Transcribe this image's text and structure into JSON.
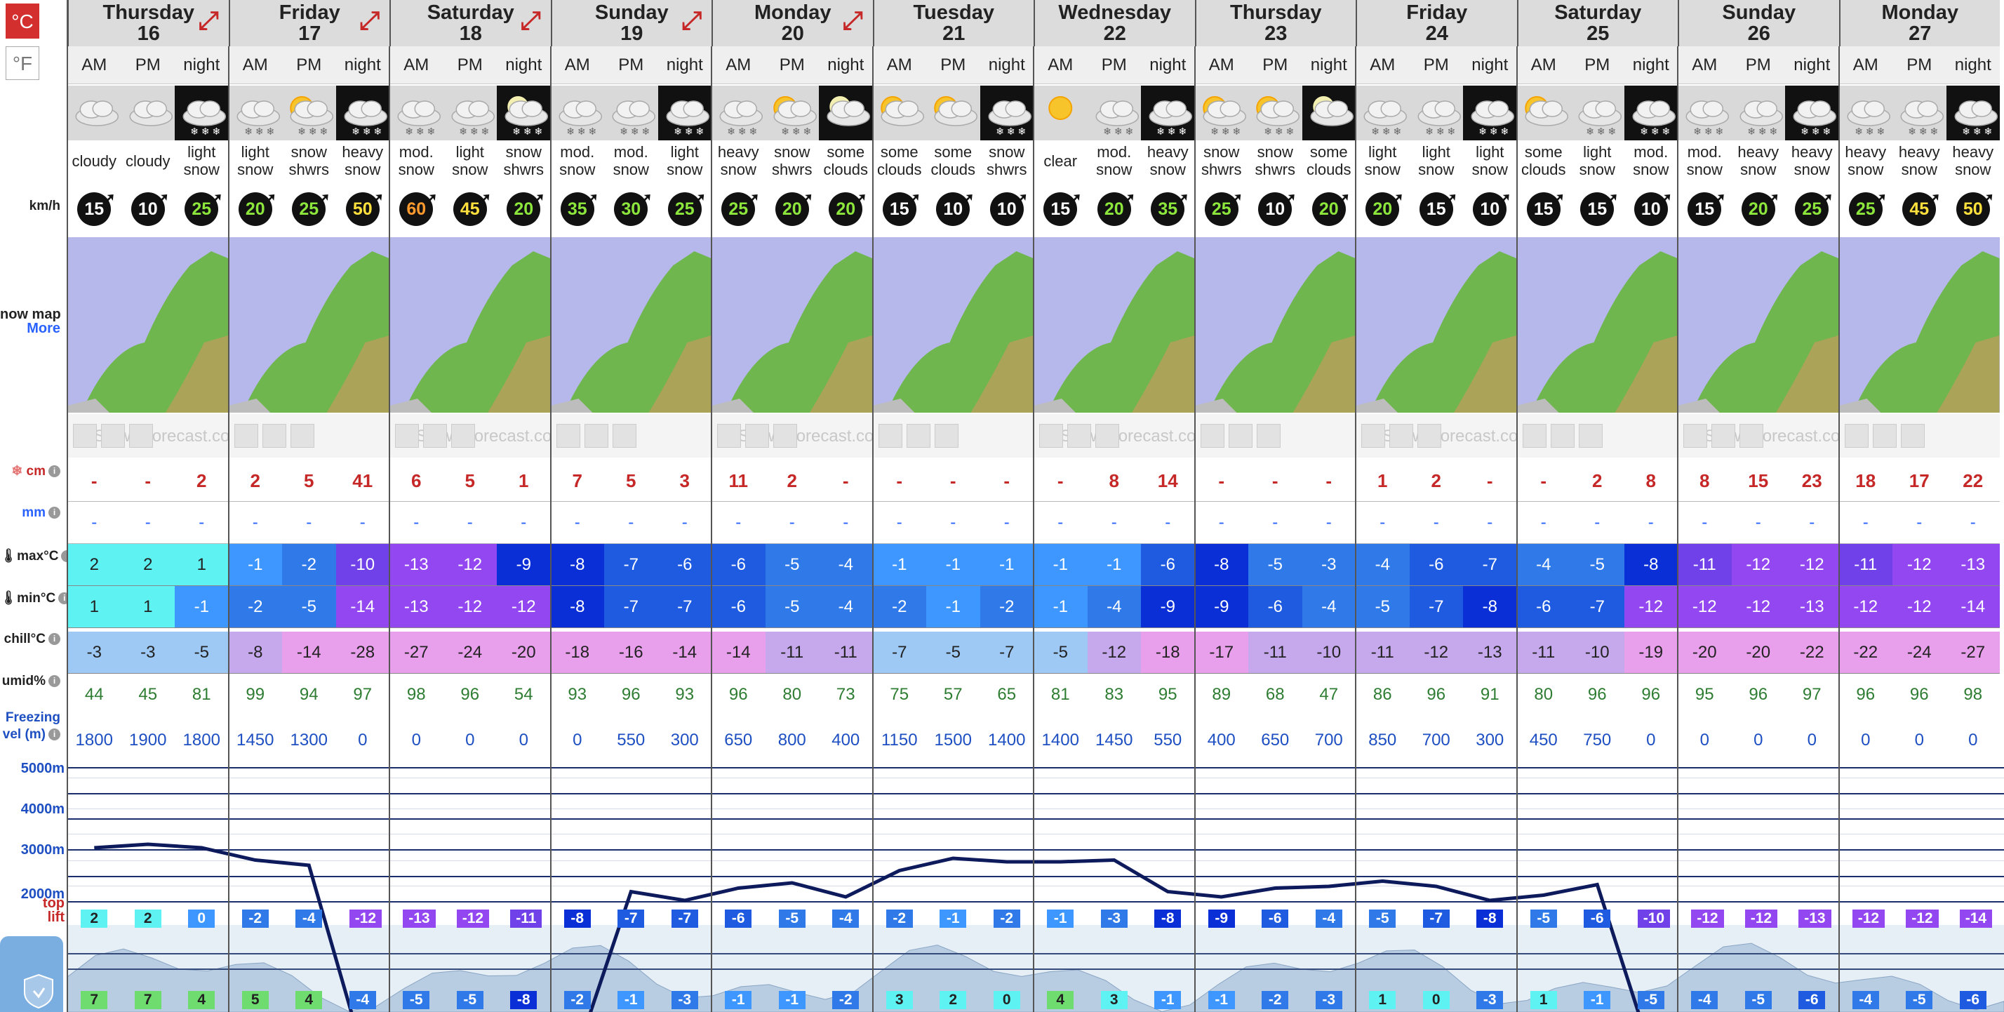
{
  "units": {
    "celsius": "°C",
    "fahrenheit": "°F"
  },
  "labels": {
    "windunit": "km/h",
    "snowmap": "now map",
    "more": "More",
    "snow": "cm",
    "rain": "mm",
    "max": "max°C",
    "min": "min°C",
    "chill": "chill°C",
    "humid": "umid%",
    "freezing1": "Freezing",
    "freezing2": "vel (m)",
    "alt5000": "5000m",
    "alt4000": "4000m",
    "alt3000": "3000m",
    "alt2000": "2000m",
    "toplift1": "top",
    "toplift2": "lift",
    "watermark": "Snow-Forecast.com"
  },
  "periods": [
    "AM",
    "PM",
    "night"
  ],
  "days": [
    {
      "name": "Thursday",
      "date": "16",
      "arrow": true
    },
    {
      "name": "Friday",
      "date": "17",
      "arrow": true
    },
    {
      "name": "Saturday",
      "date": "18",
      "arrow": true
    },
    {
      "name": "Sunday",
      "date": "19",
      "arrow": true
    },
    {
      "name": "Monday",
      "date": "20",
      "arrow": true
    },
    {
      "name": "Tuesday",
      "date": "21",
      "arrow": false
    },
    {
      "name": "Wednesday",
      "date": "22",
      "arrow": false
    },
    {
      "name": "Thursday",
      "date": "23",
      "arrow": false
    },
    {
      "name": "Friday",
      "date": "24",
      "arrow": false
    },
    {
      "name": "Saturday",
      "date": "25",
      "arrow": false
    },
    {
      "name": "Sunday",
      "date": "26",
      "arrow": false
    },
    {
      "name": "Monday",
      "date": "27",
      "arrow": false
    }
  ],
  "weather": [
    [
      "cloudy"
    ],
    [
      "cloudy"
    ],
    [
      "light",
      "snow"
    ],
    [
      "light",
      "snow"
    ],
    [
      "snow",
      "shwrs"
    ],
    [
      "heavy",
      "snow"
    ],
    [
      "mod.",
      "snow"
    ],
    [
      "light",
      "snow"
    ],
    [
      "snow",
      "shwrs"
    ],
    [
      "mod.",
      "snow"
    ],
    [
      "mod.",
      "snow"
    ],
    [
      "light",
      "snow"
    ],
    [
      "heavy",
      "snow"
    ],
    [
      "snow",
      "shwrs"
    ],
    [
      "some",
      "clouds"
    ],
    [
      "some",
      "clouds"
    ],
    [
      "some",
      "clouds"
    ],
    [
      "snow",
      "shwrs"
    ],
    [
      "clear"
    ],
    [
      "mod.",
      "snow"
    ],
    [
      "heavy",
      "snow"
    ],
    [
      "snow",
      "shwrs"
    ],
    [
      "snow",
      "shwrs"
    ],
    [
      "some",
      "clouds"
    ],
    [
      "light",
      "snow"
    ],
    [
      "light",
      "snow"
    ],
    [
      "light",
      "snow"
    ],
    [
      "some",
      "clouds"
    ],
    [
      "light",
      "snow"
    ],
    [
      "mod.",
      "snow"
    ],
    [
      "mod.",
      "snow"
    ],
    [
      "heavy",
      "snow"
    ],
    [
      "heavy",
      "snow"
    ],
    [
      "heavy",
      "snow"
    ],
    [
      "heavy",
      "snow"
    ],
    [
      "heavy",
      "snow"
    ]
  ],
  "icons": [
    "cloud",
    "cloud",
    "snow-night",
    "snow",
    "sun-snow",
    "snow-night",
    "snow",
    "snow",
    "moon-snow",
    "snow",
    "snow",
    "snow-night",
    "snow",
    "sun-snow",
    "moon-cloud",
    "sun-cloud",
    "sun-cloud",
    "snow-night",
    "sun",
    "snow",
    "snow-night",
    "sun-snow",
    "sun-snow",
    "moon-cloud",
    "snow",
    "snow",
    "snow-night",
    "sun-cloud",
    "snow",
    "snow-night",
    "snow",
    "snow",
    "snow-night",
    "snow",
    "snow",
    "snow-night"
  ],
  "wind": [
    15,
    10,
    25,
    20,
    25,
    50,
    60,
    45,
    20,
    35,
    30,
    25,
    25,
    20,
    20,
    15,
    10,
    10,
    15,
    20,
    35,
    25,
    10,
    20,
    20,
    15,
    10,
    15,
    15,
    10,
    15,
    20,
    25,
    25,
    45,
    50
  ],
  "windColors": {
    "15": "#ffffff",
    "10": "#ffffff",
    "20": "#8ce63c",
    "25": "#8ce63c",
    "30": "#8ce63c",
    "35": "#8ce63c",
    "45": "#ffe03c",
    "50": "#ffe03c",
    "60": "#ff9a2e"
  },
  "snow": [
    "-",
    "-",
    "2",
    "2",
    "5",
    "41",
    "6",
    "5",
    "1",
    "7",
    "5",
    "3",
    "11",
    "2",
    "-",
    "-",
    "-",
    "-",
    "-",
    "8",
    "14",
    "-",
    "-",
    "-",
    "1",
    "2",
    "-",
    "-",
    "2",
    "8",
    "8",
    "15",
    "23",
    "18",
    "17",
    "22"
  ],
  "rain": [
    "-",
    "-",
    "-",
    "-",
    "-",
    "-",
    "-",
    "-",
    "-",
    "-",
    "-",
    "-",
    "-",
    "-",
    "-",
    "-",
    "-",
    "-",
    "-",
    "-",
    "-",
    "-",
    "-",
    "-",
    "-",
    "-",
    "-",
    "-",
    "-",
    "-",
    "-",
    "-",
    "-",
    "-",
    "-",
    "-"
  ],
  "max": [
    2,
    2,
    1,
    -1,
    -2,
    -10,
    -13,
    -12,
    -9,
    -8,
    -7,
    -6,
    -6,
    -5,
    -4,
    -1,
    -1,
    -1,
    -1,
    -1,
    -6,
    -8,
    -5,
    -3,
    -4,
    -6,
    -7,
    -4,
    -5,
    -8,
    -11,
    -12,
    -12,
    -11,
    -12,
    -13
  ],
  "min": [
    1,
    1,
    -1,
    -2,
    -5,
    -14,
    -13,
    -12,
    -12,
    -8,
    -7,
    -7,
    -6,
    -5,
    -4,
    -2,
    -1,
    -2,
    -1,
    -4,
    -9,
    -9,
    -6,
    -4,
    -5,
    -7,
    -8,
    -6,
    -7,
    -12,
    -12,
    -12,
    -13,
    -12,
    -12,
    -14
  ],
  "chill": [
    -3,
    -3,
    -5,
    -8,
    -14,
    -28,
    -27,
    -24,
    -20,
    -18,
    -16,
    -14,
    -14,
    -11,
    -11,
    -7,
    -5,
    -7,
    -5,
    -12,
    -18,
    -17,
    -11,
    -10,
    -11,
    -12,
    -13,
    -11,
    -10,
    -19,
    -20,
    -20,
    -22,
    -22,
    -24,
    -27
  ],
  "humid": [
    44,
    45,
    81,
    99,
    94,
    97,
    98,
    96,
    54,
    93,
    96,
    93,
    96,
    80,
    73,
    75,
    57,
    65,
    81,
    83,
    95,
    89,
    68,
    47,
    86,
    96,
    91,
    80,
    96,
    96,
    95,
    96,
    97,
    96,
    96,
    98
  ],
  "freezing": [
    1800,
    1900,
    1800,
    1450,
    1300,
    0,
    0,
    0,
    0,
    0,
    550,
    300,
    650,
    800,
    400,
    1150,
    1500,
    1400,
    1400,
    1450,
    550,
    400,
    650,
    700,
    850,
    700,
    300,
    450,
    750,
    0,
    0,
    0,
    0,
    0,
    0,
    0
  ],
  "toplift": [
    2,
    2,
    0,
    -2,
    -4,
    -12,
    -13,
    -12,
    -11,
    -8,
    -7,
    -7,
    -6,
    -5,
    -4,
    -2,
    -1,
    -2,
    -1,
    -3,
    -8,
    -9,
    -6,
    -4,
    -5,
    -7,
    -8,
    -5,
    -6,
    -10,
    -12,
    -12,
    -13,
    -12,
    -12,
    -14
  ],
  "bottom": [
    7,
    7,
    4,
    5,
    4,
    -4,
    -5,
    -5,
    -8,
    -2,
    -1,
    -3,
    -1,
    -1,
    -2,
    3,
    2,
    0,
    4,
    3,
    -1,
    -1,
    -2,
    -3,
    1,
    0,
    -3,
    1,
    -1,
    -5,
    -4,
    -5,
    -6,
    -4,
    -5,
    -6
  ]
}
